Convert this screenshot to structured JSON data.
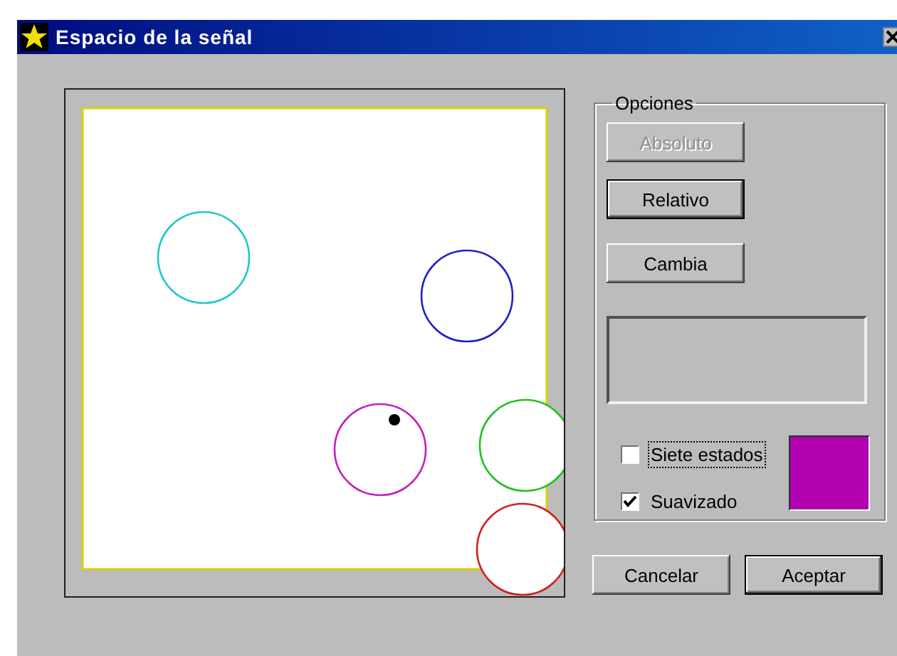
{
  "window": {
    "title": "Espacio de la señal"
  },
  "canvas": {
    "circles": [
      {
        "color": "#20c8c8"
      },
      {
        "color": "#2020c8"
      },
      {
        "color": "#c020c0"
      },
      {
        "color": "#20c020"
      },
      {
        "color": "#d02020"
      }
    ]
  },
  "options": {
    "title": "Opciones",
    "buttons": [
      {
        "label": "Absoluto",
        "disabled": true,
        "default": false
      },
      {
        "label": "Relativo",
        "disabled": false,
        "default": true
      },
      {
        "label": "Cambia",
        "disabled": false,
        "default": false
      }
    ],
    "checkboxes": [
      {
        "label": "Siete estados",
        "checked": false,
        "focused": true
      },
      {
        "label": "Suavizado",
        "checked": true,
        "focused": false
      }
    ],
    "swatch": {
      "color": "#b000b0"
    }
  },
  "buttons": [
    {
      "label": "Cancelar",
      "default": false
    },
    {
      "label": "Aceptar",
      "default": true
    }
  ]
}
